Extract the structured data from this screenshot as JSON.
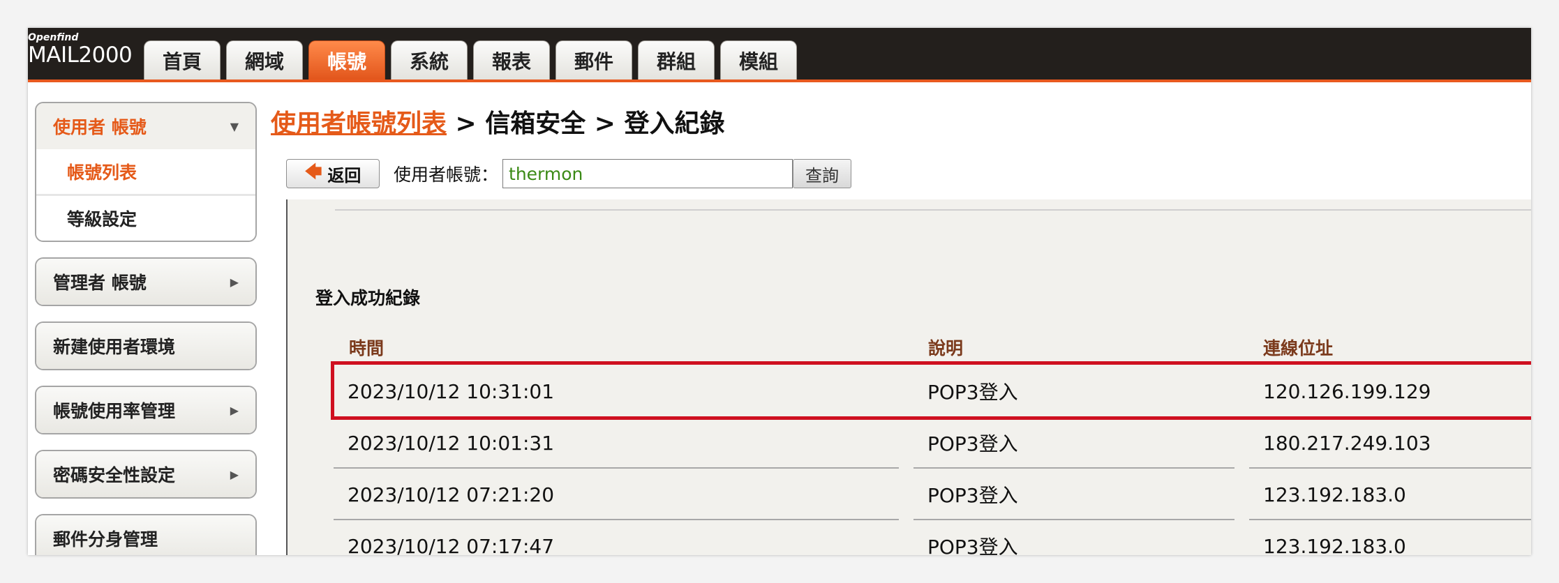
{
  "brand": {
    "small": "Openfind",
    "big": "MAIL2000"
  },
  "tabs": [
    {
      "label": "首頁",
      "active": false
    },
    {
      "label": "網域",
      "active": false
    },
    {
      "label": "帳號",
      "active": true
    },
    {
      "label": "系統",
      "active": false
    },
    {
      "label": "報表",
      "active": false
    },
    {
      "label": "郵件",
      "active": false
    },
    {
      "label": "群組",
      "active": false
    },
    {
      "label": "模組",
      "active": false
    }
  ],
  "sidebar": {
    "user_account": {
      "label": "使用者 帳號",
      "sub": [
        "帳號列表",
        "等級設定"
      ]
    },
    "admin_account": {
      "label": "管理者 帳號"
    },
    "new_user_env": {
      "label": "新建使用者環境"
    },
    "usage_mgmt": {
      "label": "帳號使用率管理"
    },
    "password_security": {
      "label": "密碼安全性設定"
    },
    "mail_alias": {
      "label": "郵件分身管理"
    }
  },
  "breadcrumb": {
    "link": "使用者帳號列表",
    "sep1": " > ",
    "mid": "信箱安全",
    "sep2": " > ",
    "current": "登入紀錄"
  },
  "toolbar": {
    "back_label": "返回",
    "user_label": "使用者帳號：",
    "user_value": "thermon",
    "query_label": "查詢"
  },
  "section_title": "登入成功紀錄",
  "columns": [
    "時間",
    "說明",
    "連線位址"
  ],
  "records": [
    {
      "time": "2023/10/12 10:31:01",
      "desc": "POP3登入",
      "ip": "120.126.199.129",
      "highlighted": true
    },
    {
      "time": "2023/10/12 10:01:31",
      "desc": "POP3登入",
      "ip": "180.217.249.103",
      "highlighted": false
    },
    {
      "time": "2023/10/12 07:21:20",
      "desc": "POP3登入",
      "ip": "123.192.183.0",
      "highlighted": false
    },
    {
      "time": "2023/10/12 07:17:47",
      "desc": "POP3登入",
      "ip": "123.192.183.0",
      "highlighted": false
    }
  ],
  "colors": {
    "accent": "#e55a19",
    "highlight": "#cf1020",
    "topbar": "#231f1c",
    "header_text": "#7b3a1c"
  }
}
